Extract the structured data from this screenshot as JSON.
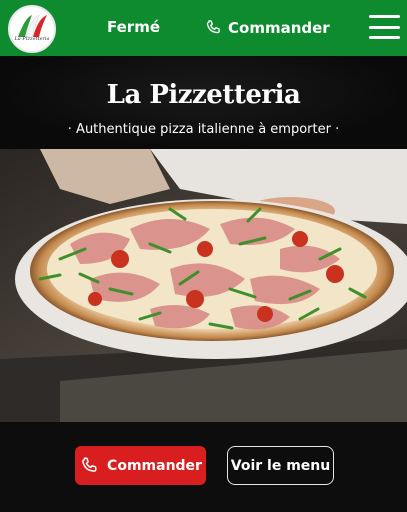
{
  "header": {
    "logo_text": "La Pizzetteria",
    "status": "Fermé",
    "order_label": "Commander",
    "menu_icon": "hamburger-icon",
    "background_color": "#0e8a2f"
  },
  "hero": {
    "title": "La Pizzetteria",
    "subtitle": "· Authentique pizza italienne à emporter ·",
    "image": "pizza-photo"
  },
  "actions": {
    "order_label": "Commander",
    "order_icon": "phone-icon",
    "order_color": "#d81e1e",
    "menu_label": "Voir le menu"
  }
}
